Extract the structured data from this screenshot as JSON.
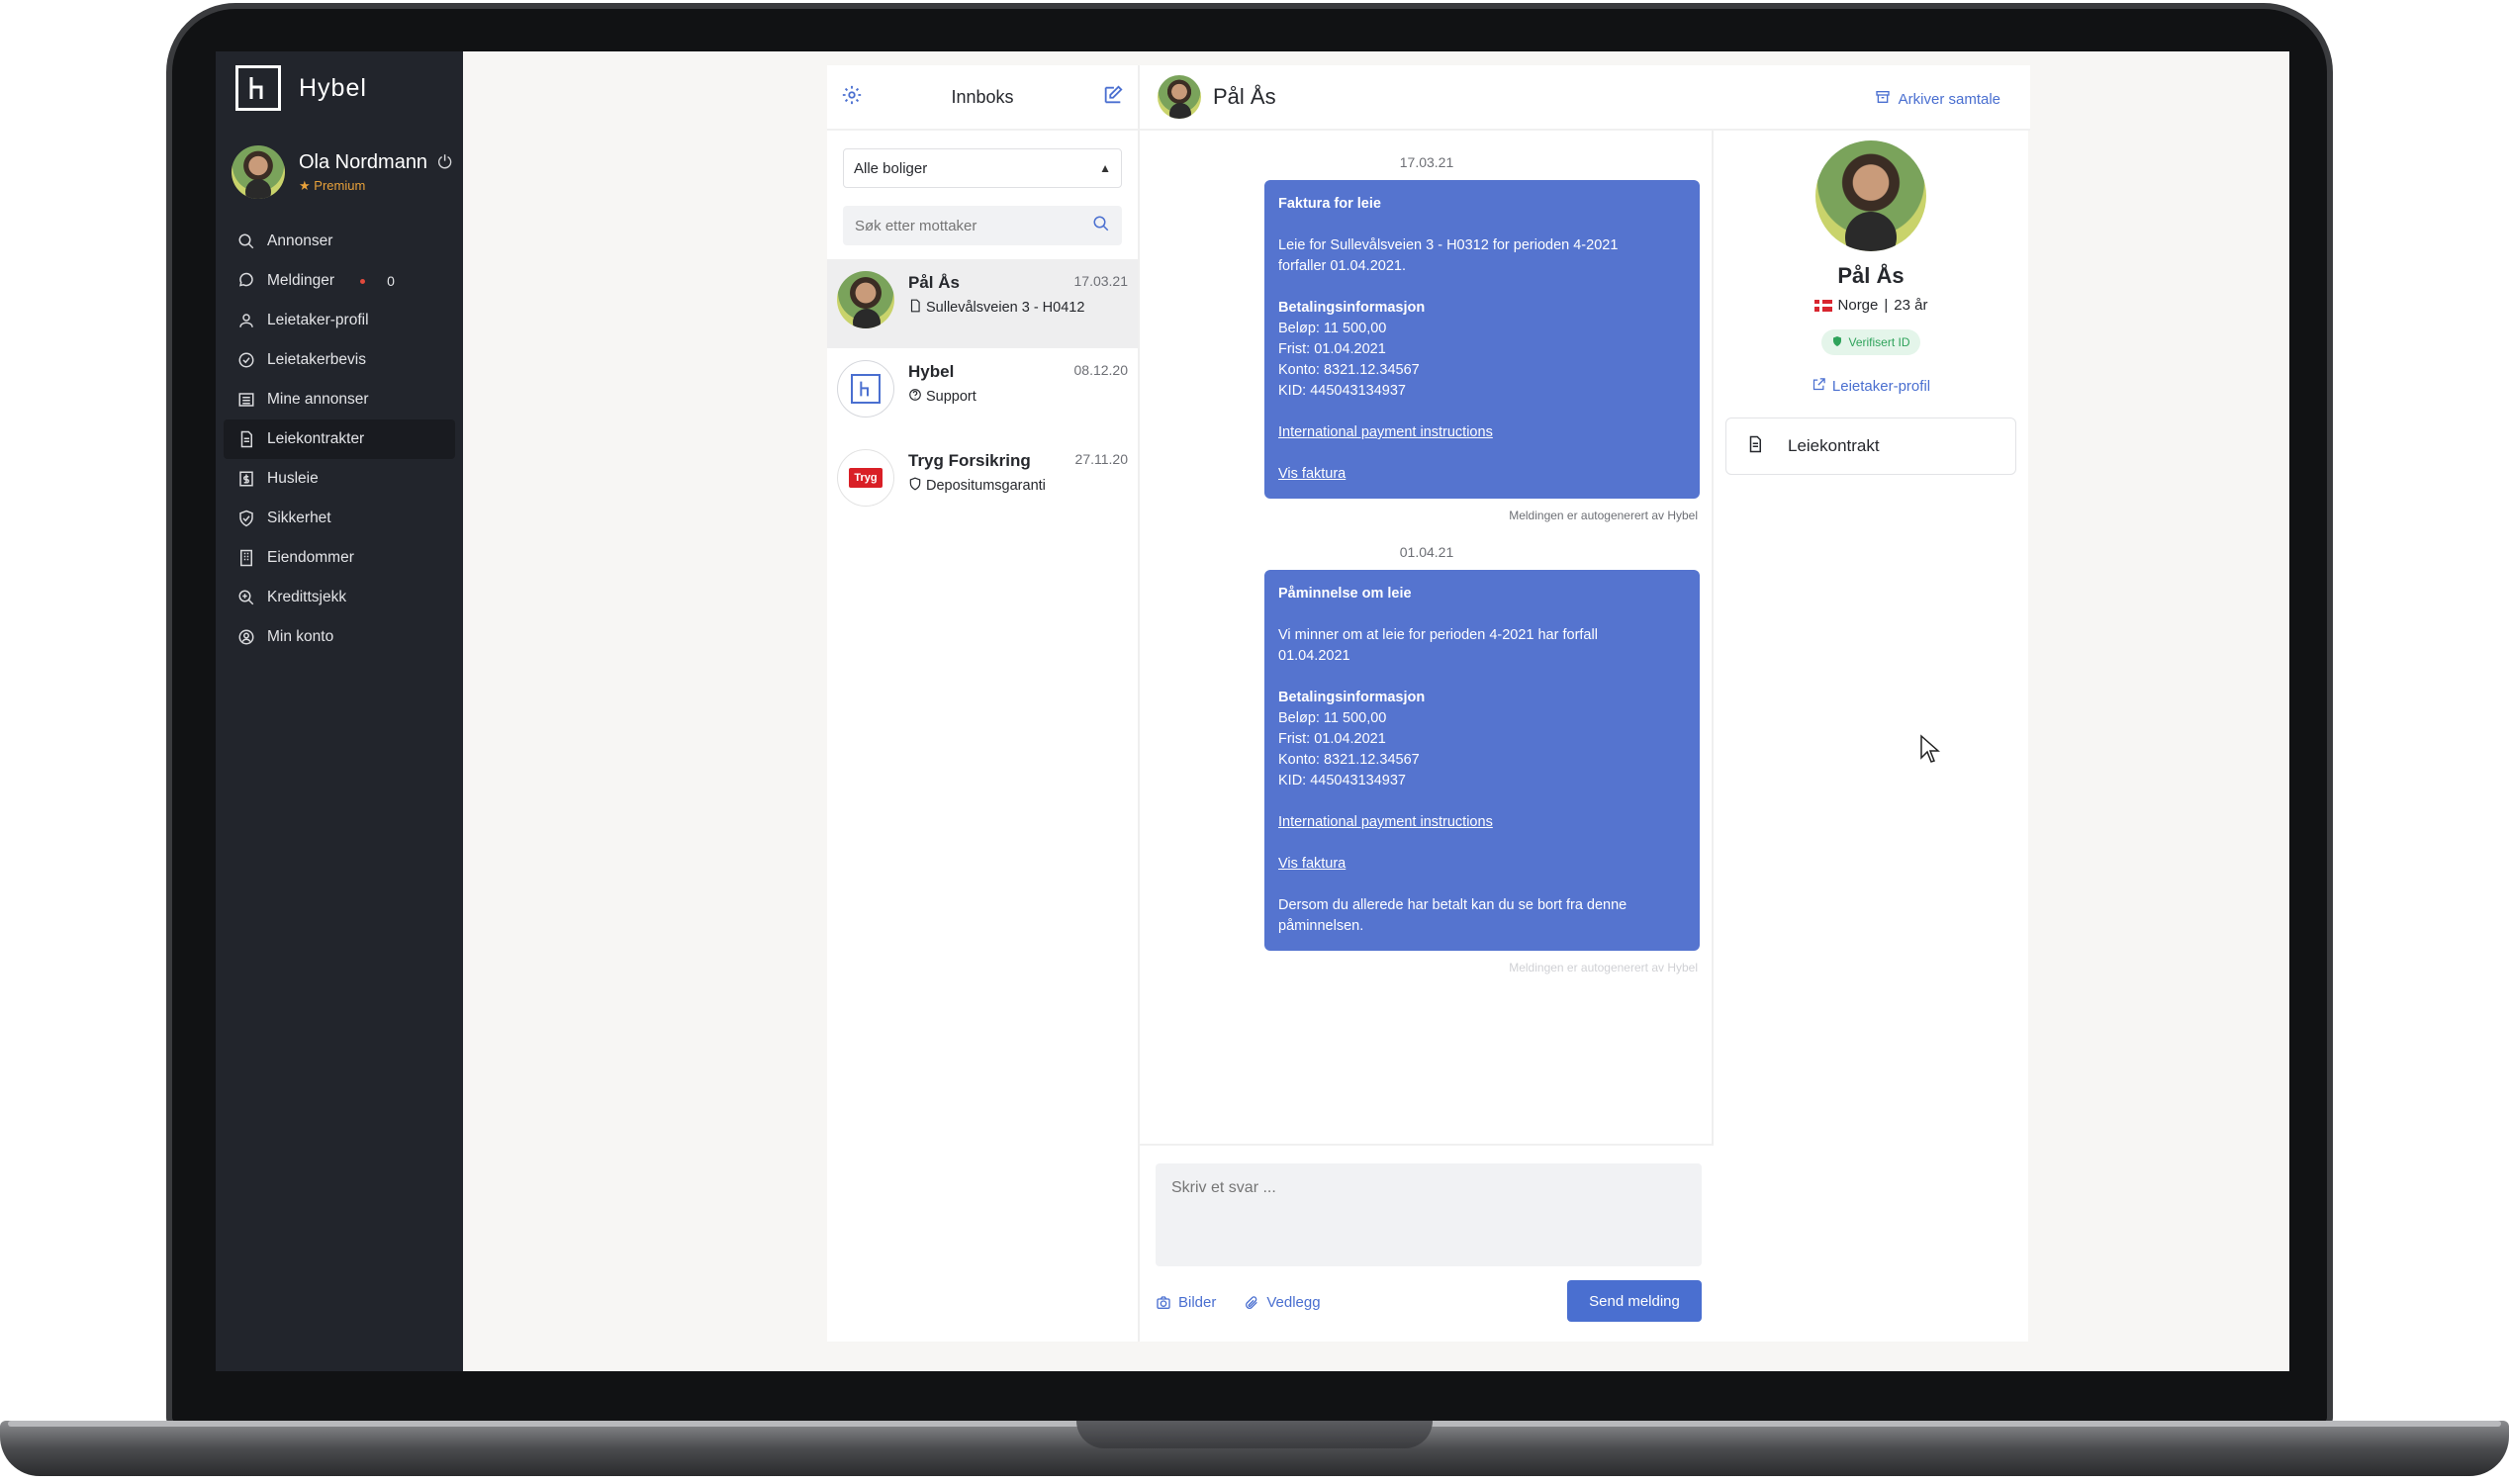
{
  "app": {
    "name": "Hybel"
  },
  "user": {
    "name": "Ola Nordmann",
    "tier": "Premium"
  },
  "sidebar": {
    "items": [
      {
        "label": "Annonser",
        "icon": "search-icon"
      },
      {
        "label": "Meldinger",
        "icon": "chat-icon",
        "count": "0"
      },
      {
        "label": "Leietaker-profil",
        "icon": "user-icon"
      },
      {
        "label": "Leietakerbevis",
        "icon": "check-circle-icon"
      },
      {
        "label": "Mine annonser",
        "icon": "list-icon"
      },
      {
        "label": "Leiekontrakter",
        "icon": "document-icon",
        "active": true
      },
      {
        "label": "Husleie",
        "icon": "dollar-icon"
      },
      {
        "label": "Sikkerhet",
        "icon": "shield-check-icon"
      },
      {
        "label": "Eiendommer",
        "icon": "building-icon"
      },
      {
        "label": "Kredittsjekk",
        "icon": "zoom-icon"
      },
      {
        "label": "Min konto",
        "icon": "account-icon"
      }
    ]
  },
  "inbox": {
    "title": "Innboks",
    "filter_value": "Alle boliger",
    "search_placeholder": "Søk etter mottaker",
    "threads": [
      {
        "name": "Pål Ås",
        "date": "17.03.21",
        "subtitle": "Sullevålsveien 3 - H0412",
        "icon": "document-icon"
      },
      {
        "name": "Hybel",
        "date": "08.12.20",
        "subtitle": "Support",
        "icon": "help-icon"
      },
      {
        "name": "Tryg Forsikring",
        "date": "27.11.20",
        "subtitle": "Depositumsgaranti",
        "icon": "shield-icon",
        "logo_text": "Tryg"
      }
    ]
  },
  "conversation": {
    "name": "Pål Ås",
    "archive_label": "Arkiver samtale",
    "messages": [
      {
        "date": "17.03.21",
        "title": "Faktura for leie",
        "body1": "Leie for Sullevålsveien 3 - H0312 for perioden 4-2021",
        "body2": "forfaller 01.04.2021.",
        "pay_title": "Betalingsinformasjon",
        "amount": "Beløp: 11 500,00",
        "due": "Frist: 01.04.2021",
        "account": "Konto: 8321.12.34567",
        "kid": "KID: 445043134937",
        "link1": "International payment instructions",
        "link2": "Vis faktura",
        "footer": "Meldingen er autogenerert av Hybel"
      },
      {
        "date": "01.04.21",
        "title": "Påminnelse om leie",
        "body1": "Vi minner om at leie for perioden 4-2021 har forfall",
        "body2": "01.04.2021",
        "pay_title": "Betalingsinformasjon",
        "amount": "Beløp: 11 500,00",
        "due": "Frist: 01.04.2021",
        "account": "Konto: 8321.12.34567",
        "kid": "KID: 445043134937",
        "link1": "International payment instructions",
        "link2": "Vis faktura",
        "note1": "Dersom du allerede har betalt kan du se bort fra denne",
        "note2": "påminnelsen.",
        "footer": "Meldingen er autogenerert av Hybel"
      }
    ],
    "reply_placeholder": "Skriv et svar ...",
    "images_label": "Bilder",
    "attachment_label": "Vedlegg",
    "send_label": "Send melding"
  },
  "profile": {
    "name": "Pål Ås",
    "country": "Norge",
    "separator": "|",
    "age": "23 år",
    "verified_label": "Verifisert ID",
    "profile_link": "Leietaker-profil",
    "contract_label": "Leiekontrakt"
  },
  "colors": {
    "accent": "#4a6fd0",
    "bubble": "#5574cf",
    "sidebar": "#22252c",
    "verified": "#2fa35b"
  }
}
